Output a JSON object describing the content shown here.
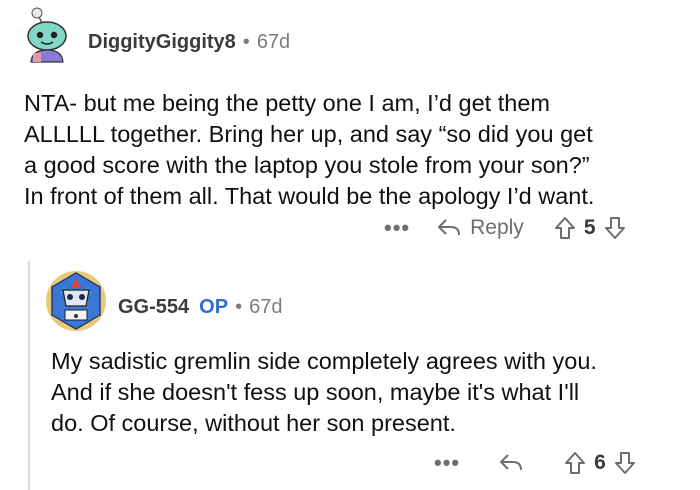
{
  "comments": [
    {
      "username": "DiggityGiggity8",
      "separator": "•",
      "age": "67d",
      "text_lines": [
        "NTA- but me being the petty one I am, I’d get them",
        "ALLLLL together. Bring her up, and say “so did you get",
        "a good score with the laptop you stole from your son?”",
        "In front of them all. That would be the apology I’d want."
      ],
      "more": "•••",
      "reply_label": "Reply",
      "votes": "5"
    },
    {
      "username": "GG-554",
      "op_badge": "OP",
      "separator": "•",
      "age": "67d",
      "text_lines": [
        "My sadistic gremlin side completely agrees with you.",
        "And if she doesn't fess up soon, maybe it's what I'll",
        "do. Of course, without her son present."
      ],
      "more": "•••",
      "votes": "6"
    }
  ],
  "colors": {
    "text": "#111111",
    "meta": "#7c7c7c",
    "op": "#2f6fd1",
    "icon": "#6e6e6e",
    "thread": "#d9d9d9"
  },
  "icons": [
    "avatar-snoo-icon",
    "avatar-robot-icon",
    "more-options-icon",
    "reply-icon",
    "upvote-icon",
    "downvote-icon"
  ]
}
